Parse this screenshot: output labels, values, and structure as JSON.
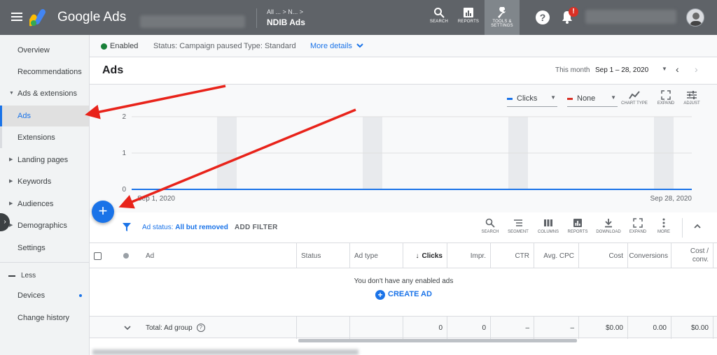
{
  "app": {
    "brand": "Google Ads",
    "breadcrumb": "All ...  >  N...  >",
    "account_name": "NDIB Ads"
  },
  "toolbar": {
    "search": "SEARCH",
    "reports": "REPORTS",
    "tools": "TOOLS & SETTINGS",
    "notification_count": "!"
  },
  "sidebar": {
    "items": [
      {
        "label": "Overview"
      },
      {
        "label": "Recommendations"
      },
      {
        "label": "Ads & extensions"
      },
      {
        "label": "Ads"
      },
      {
        "label": "Extensions"
      },
      {
        "label": "Landing pages"
      },
      {
        "label": "Keywords"
      },
      {
        "label": "Audiences"
      },
      {
        "label": "Demographics"
      },
      {
        "label": "Settings"
      }
    ],
    "less_label": "Less",
    "extra": [
      {
        "label": "Devices"
      },
      {
        "label": "Change history"
      }
    ]
  },
  "status": {
    "enabled": "Enabled",
    "status_text": "Status: Campaign paused",
    "type_text": "Type: Standard",
    "more_details": "More details"
  },
  "page": {
    "title": "Ads",
    "period_label": "This month",
    "period_value": "Sep 1 – 28, 2020"
  },
  "chart": {
    "metric1": "Clicks",
    "metric2": "None",
    "tools": {
      "chart_type": "CHART TYPE",
      "expand": "EXPAND",
      "adjust": "ADJUST"
    }
  },
  "chart_data": {
    "type": "line",
    "x": [
      "Sep 1, 2020",
      "Sep 28, 2020"
    ],
    "yticks": [
      "0",
      "1",
      "2"
    ],
    "ylim": [
      0,
      2
    ],
    "series": [
      {
        "name": "Clicks",
        "values": [
          0,
          0
        ]
      }
    ],
    "start_label": "Sep 1, 2020",
    "end_label": "Sep 28, 2020"
  },
  "filter": {
    "prefix": "Ad status: ",
    "value": "All but removed",
    "add": "ADD FILTER"
  },
  "table_tools": {
    "search": "SEARCH",
    "segment": "SEGMENT",
    "columns": "COLUMNS",
    "reports": "REPORTS",
    "download": "DOWNLOAD",
    "expand": "EXPAND",
    "more": "MORE"
  },
  "table": {
    "headers": {
      "ad": "Ad",
      "status": "Status",
      "ad_type": "Ad type",
      "clicks": "Clicks",
      "impr": "Impr.",
      "ctr": "CTR",
      "avg_cpc": "Avg. CPC",
      "cost": "Cost",
      "conversions": "Conversions",
      "cost_conv": "Cost / conv."
    },
    "empty_message": "You don't have any enabled ads",
    "create_ad": "CREATE AD",
    "total": {
      "label": "Total: Ad group",
      "clicks": "0",
      "impr": "0",
      "ctr": "–",
      "avg_cpc": "–",
      "cost": "$0.00",
      "conversions": "0.00",
      "cost_conv": "$0.00"
    }
  },
  "colors": {
    "accent": "#1a73e8",
    "topbar": "#5f6368",
    "enabled": "#188038",
    "annotation": "#e8231a"
  }
}
